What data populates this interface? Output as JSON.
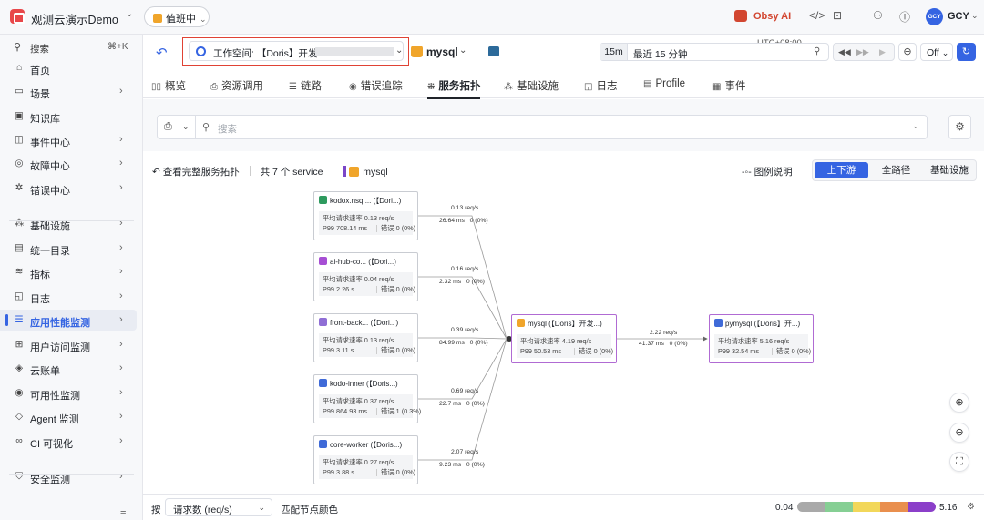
{
  "topbar": {
    "brand": "观测云演示Demo",
    "duty": "值班中",
    "ai_label": "Obsy AI",
    "avatar": "GCY",
    "user": "GCY"
  },
  "sidebar": {
    "search_label": "搜索",
    "search_shortcut": "⌘+K",
    "items": [
      {
        "label": "首页",
        "icon": "home-icon",
        "glyph": "⌂",
        "chev": ""
      },
      {
        "label": "场景",
        "icon": "scene-icon",
        "glyph": "▭",
        "chev": "›"
      },
      {
        "label": "知识库",
        "icon": "book-icon",
        "glyph": "▣",
        "chev": ""
      },
      {
        "label": "事件中心",
        "icon": "event-icon",
        "glyph": "◫",
        "chev": "›"
      },
      {
        "label": "故障中心",
        "icon": "fault-icon",
        "glyph": "◎",
        "chev": "›"
      },
      {
        "label": "错误中心",
        "icon": "bug-icon",
        "glyph": "✲",
        "chev": "›"
      },
      {
        "label": "基础设施",
        "icon": "infra-icon",
        "glyph": "⁂",
        "chev": "›"
      },
      {
        "label": "统一目录",
        "icon": "catalog-icon",
        "glyph": "▤",
        "chev": "›"
      },
      {
        "label": "指标",
        "icon": "metric-icon",
        "glyph": "≋",
        "chev": "›"
      },
      {
        "label": "日志",
        "icon": "log-icon",
        "glyph": "◱",
        "chev": "›"
      },
      {
        "label": "应用性能监测",
        "icon": "apm-icon",
        "glyph": "☰",
        "chev": "›"
      },
      {
        "label": "用户访问监测",
        "icon": "rum-icon",
        "glyph": "⊞",
        "chev": "›"
      },
      {
        "label": "云账单",
        "icon": "bill-icon",
        "glyph": "◈",
        "chev": "›"
      },
      {
        "label": "可用性监测",
        "icon": "dial-icon",
        "glyph": "◉",
        "chev": "›"
      },
      {
        "label": "Agent 监测",
        "icon": "agent-icon",
        "glyph": "◇",
        "chev": "›"
      },
      {
        "label": "CI 可视化",
        "icon": "ci-icon",
        "glyph": "∞",
        "chev": "›"
      },
      {
        "label": "安全监测",
        "icon": "shield-icon",
        "glyph": "⛉",
        "chev": "›"
      }
    ]
  },
  "header": {
    "workspace_label": "工作空间: 【Doris】开发",
    "service": "mysql",
    "utc": "UTC+08:00",
    "time_tag": "15m",
    "time_label": "最近 15 分钟",
    "off_label": "Off"
  },
  "tabs": [
    {
      "label": "概览",
      "glyph": "▯▯"
    },
    {
      "label": "资源调用",
      "glyph": "⎙"
    },
    {
      "label": "链路",
      "glyph": "☰"
    },
    {
      "label": "错误追踪",
      "glyph": "◉"
    },
    {
      "label": "服务拓扑",
      "glyph": "⁜"
    },
    {
      "label": "基础设施",
      "glyph": "⁂"
    },
    {
      "label": "日志",
      "glyph": "◱"
    },
    {
      "label": "Profile",
      "glyph": "▤"
    },
    {
      "label": "事件",
      "glyph": "▦"
    }
  ],
  "filter": {
    "placeholder": "搜索"
  },
  "topology": {
    "back_label": "查看完整服务拓扑",
    "count_label": "共 7 个 service",
    "current": "mysql",
    "legend_label": "图例说明",
    "modes": [
      "上下游",
      "全路径",
      "基础设施"
    ]
  },
  "nodes": {
    "upstream": [
      {
        "title": "kodox.nsq.... (【Dori...)",
        "rate": "平均请求速率 0.13 req/s",
        "p99": "P99 708.14 ms",
        "err": "错误 0 (0%)",
        "icon_color": "#2e9a5e"
      },
      {
        "title": "ai-hub-co... (【Dori...)",
        "rate": "平均请求速率 0.04 req/s",
        "p99": "P99 2.26 s",
        "err": "错误 0 (0%)",
        "icon_color": "#a64ed4"
      },
      {
        "title": "front-back... (【Dori...)",
        "rate": "平均请求速率 0.13 req/s",
        "p99": "P99 3.11 s",
        "err": "错误 0 (0%)",
        "icon_color": "#8f6ed5"
      },
      {
        "title": "kodo-inner (【Doris...)",
        "rate": "平均请求速率 0.37 req/s",
        "p99": "P99 864.93 ms",
        "err": "错误 1 (0.3%)",
        "icon_color": "#3f6ad8"
      },
      {
        "title": "core-worker (【Doris...)",
        "rate": "平均请求速率 0.27 req/s",
        "p99": "P99 3.88 s",
        "err": "错误 0 (0%)",
        "icon_color": "#3f6ad8"
      }
    ],
    "center": {
      "title": "mysql (【Doris】开发...)",
      "rate": "平均请求速率 4.19 req/s",
      "p99": "P99 50.53 ms",
      "err": "错误 0 (0%)",
      "icon_color": "#f0a52b"
    },
    "downstream": {
      "title": "pymysql (【Doris】开...)",
      "rate": "平均请求速率 5.16 req/s",
      "p99": "P99 32.54 ms",
      "err": "错误 0 (0%)",
      "icon_color": "#3f6ad8"
    }
  },
  "edges": {
    "upstream": [
      {
        "rate": "0.13 req/s",
        "latency": "26.64 ms",
        "err": "0 (0%)"
      },
      {
        "rate": "0.16 req/s",
        "latency": "2.32 ms",
        "err": "0 (0%)"
      },
      {
        "rate": "0.39 req/s",
        "latency": "84.99 ms",
        "err": "0 (0%)"
      },
      {
        "rate": "0.69 req/s",
        "latency": "22.7 ms",
        "err": "0 (0%)"
      },
      {
        "rate": "2.07 req/s",
        "latency": "9.23 ms",
        "err": "0 (0%)"
      }
    ],
    "downstream": {
      "rate": "2.22 req/s",
      "latency": "41.37 ms",
      "err": "0 (0%)"
    }
  },
  "bottom": {
    "prefix": "按",
    "metric": "请求数 (req/s)",
    "color_label": "匹配节点颜色",
    "min": "0.04",
    "max": "5.16",
    "scale_colors": [
      "#a9a9a9",
      "#86cf94",
      "#f2d75a",
      "#e98f4e",
      "#8b3fc9"
    ]
  }
}
